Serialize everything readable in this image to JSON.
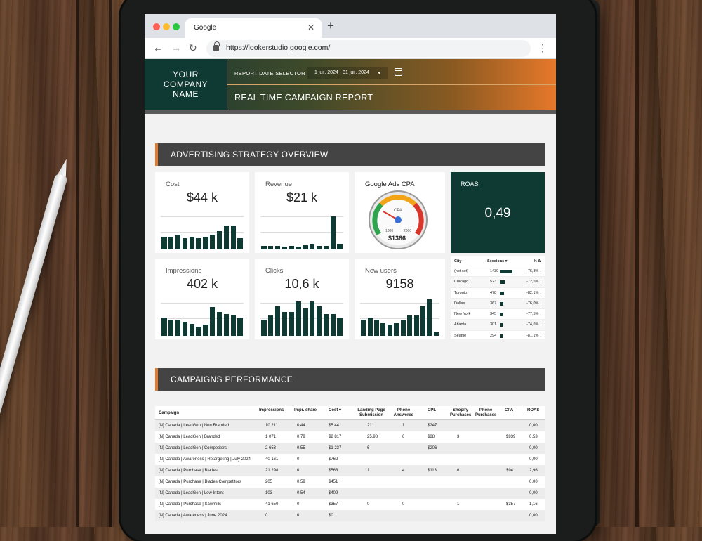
{
  "browser": {
    "tab_title": "Google",
    "url": "https://lookerstudio.google.com/"
  },
  "report": {
    "company_name": "YOUR COMPANY NAME",
    "date_selector_label": "REPORT DATE SELECTOR",
    "date_range": "1 juil. 2024 - 31 juil. 2024",
    "title": "REAL TIME CAMPAIGN REPORT"
  },
  "overview": {
    "section_title": "ADVERTISING STRATEGY OVERVIEW",
    "cost": {
      "title": "Cost",
      "value": "$44 k",
      "bars": [
        0.35,
        0.35,
        0.4,
        0.3,
        0.35,
        0.3,
        0.35,
        0.4,
        0.5,
        0.65,
        0.65,
        0.3
      ]
    },
    "revenue": {
      "title": "Revenue",
      "value": "$21 k",
      "bars": [
        0.1,
        0.1,
        0.1,
        0.08,
        0.1,
        0.08,
        0.12,
        0.15,
        0.1,
        0.1,
        0.9,
        0.15
      ]
    },
    "cpa": {
      "title": "Google Ads CPA",
      "gauge_label": "CPA",
      "min_label": "1000",
      "max_label": "2000",
      "value": "$1366",
      "fraction": 0.37
    },
    "roas": {
      "title": "ROAS",
      "value": "0,49"
    },
    "impressions": {
      "title": "Impressions",
      "value": "402 k",
      "bars": [
        0.5,
        0.45,
        0.45,
        0.38,
        0.32,
        0.25,
        0.3,
        0.78,
        0.65,
        0.6,
        0.58,
        0.5
      ]
    },
    "clicks": {
      "title": "Clicks",
      "value": "10,6 k",
      "bars": [
        0.45,
        0.55,
        0.8,
        0.65,
        0.65,
        0.95,
        0.75,
        0.95,
        0.8,
        0.6,
        0.6,
        0.5
      ]
    },
    "new_users": {
      "title": "New users",
      "value": "9158",
      "bars": [
        0.45,
        0.5,
        0.45,
        0.35,
        0.3,
        0.35,
        0.42,
        0.55,
        0.55,
        0.8,
        1.0,
        0.1
      ]
    }
  },
  "city_table": {
    "headers": [
      "City",
      "Sessions ▾",
      "% Δ"
    ],
    "rows": [
      {
        "city": "(not set)",
        "sessions": "1430",
        "bar": 1.0,
        "delta": "-76,8% ↓"
      },
      {
        "city": "Chicago",
        "sessions": "523",
        "bar": 0.37,
        "delta": "-72,5% ↓"
      },
      {
        "city": "Toronto",
        "sessions": "478",
        "bar": 0.33,
        "delta": "-82,1% ↓"
      },
      {
        "city": "Dallas",
        "sessions": "367",
        "bar": 0.26,
        "delta": "-76,0% ↓"
      },
      {
        "city": "New York",
        "sessions": "345",
        "bar": 0.24,
        "delta": "-77,5% ↓"
      },
      {
        "city": "Atlanta",
        "sessions": "301",
        "bar": 0.21,
        "delta": "-74,6% ↓"
      },
      {
        "city": "Seattle",
        "sessions": "294",
        "bar": 0.2,
        "delta": "-81,1% ↓"
      }
    ]
  },
  "campaigns": {
    "section_title": "CAMPAIGNS PERFORMANCE",
    "headers": [
      "Campaign",
      "Impressions",
      "Impr. share",
      "Cost ▾",
      "Landing Page Submission",
      "Phone Answered",
      "CPL",
      "Shopify Purchases",
      "Phone Purchases",
      "CPA",
      "ROAS"
    ],
    "rows": [
      [
        "[N] Canada | LeadGen | Non Branded",
        "10 211",
        "0,44",
        "$5 441",
        "21",
        "1",
        "$247",
        "",
        "",
        "",
        "0,00"
      ],
      [
        "[N] Canada | LeadGen | Branded",
        "1 071",
        "0,79",
        "$2 817",
        "25,98",
        "6",
        "$88",
        "3",
        "",
        "$939",
        "0,53"
      ],
      [
        "[N] Canada | LeadGen | Competitors",
        "2 653",
        "0,55",
        "$1 237",
        "6",
        "",
        "$206",
        "",
        "",
        "",
        "0,00"
      ],
      [
        "[N] Canada | Awareness | Retargeting | July 2024",
        "40 161",
        "0",
        "$762",
        "",
        "",
        "",
        "",
        "",
        "",
        "0,00"
      ],
      [
        "[N] Canada | Purchase | Blades",
        "21 298",
        "0",
        "$563",
        "1",
        "4",
        "$113",
        "6",
        "",
        "$94",
        "2,96"
      ],
      [
        "[N] Canada | Purchase | Blades Competitors",
        "205",
        "0,59",
        "$451",
        "",
        "",
        "",
        "",
        "",
        "",
        "0,00"
      ],
      [
        "[N] Canada | LeadGen | Low Intent",
        "103",
        "0,54",
        "$409",
        "",
        "",
        "",
        "",
        "",
        "",
        "0,00"
      ],
      [
        "[N] Canada | Purchase | Sawmills",
        "41 650",
        "0",
        "$357",
        "0",
        "0",
        "",
        "1",
        "",
        "$357",
        "1,16"
      ],
      [
        "[N] Canada | Awareness | June 2024",
        "0",
        "0",
        "$0",
        "",
        "",
        "",
        "",
        "",
        "",
        "0,00"
      ]
    ]
  },
  "colors": {
    "brand_green": "#0f3a33",
    "accent_orange": "#e6782a",
    "section_gray": "#444444"
  },
  "icons": [
    "back-arrow-icon",
    "forward-arrow-icon",
    "reload-icon",
    "lock-icon",
    "kebab-menu-icon",
    "calendar-icon",
    "close-icon",
    "new-tab-icon"
  ]
}
